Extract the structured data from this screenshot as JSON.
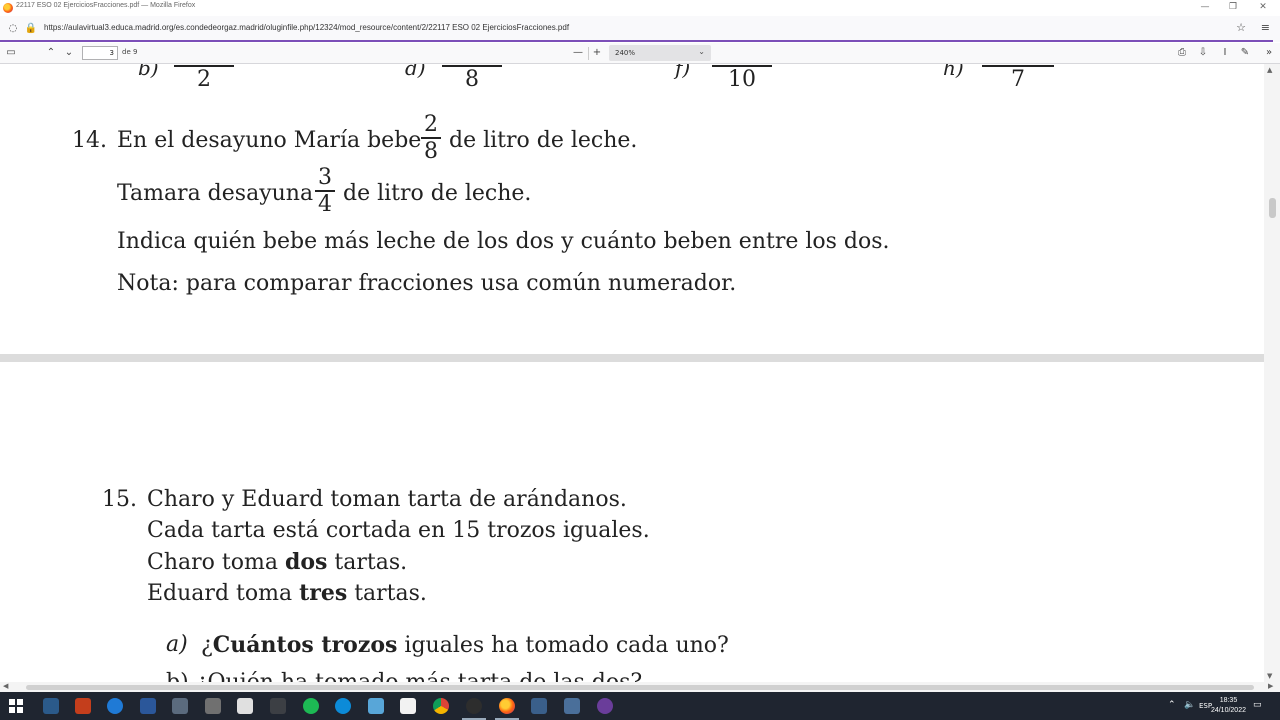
{
  "window": {
    "title": "22117 ESO 02 EjerciciosFracciones.pdf — Mozilla Firefox",
    "minimize": "—",
    "maximize": "❐",
    "close": "✕"
  },
  "urlbar": {
    "url": "https://aulavirtual3.educa.madrid.org/es.condedeorgaz.madrid/oluginfile.php/12324/mod_resource/content/2/22117 ESO 02 EjerciciosFracciones.pdf"
  },
  "pdf_toolbar": {
    "page_number": "3",
    "page_count": "de 9",
    "zoom": "240%",
    "zoom_minus": "—",
    "zoom_plus": "+"
  },
  "document": {
    "top_fragment": {
      "labels": [
        "b)",
        "d)",
        "f)",
        "h)"
      ],
      "denominators": [
        "2",
        "8",
        "10",
        "7"
      ]
    },
    "ex14": {
      "number": "14.",
      "line1_a": "En el desayuno María bebe",
      "frac1_num": "2",
      "frac1_den": "8",
      "line1_b": "de litro de leche.",
      "line2_a": "Tamara desayuna",
      "frac2_num": "3",
      "frac2_den": "4",
      "line2_b": "de litro de leche.",
      "line3": "Indica quién bebe más leche de los dos y cuánto beben entre los dos.",
      "line4": "Nota: para comparar fracciones usa común numerador."
    },
    "ex15": {
      "number": "15.",
      "line1": "Charo y Eduard toman tarta de arándanos.",
      "line2": "Cada tarta está cortada en 15 trozos iguales.",
      "line3_a": "Charo toma ",
      "line3_bold": "dos",
      "line3_b": " tartas.",
      "line4_a": "Eduard toma ",
      "line4_bold": "tres",
      "line4_b": " tartas.",
      "item_a_label": "a)",
      "item_a_pre": "¿",
      "item_a_bold": "Cuántos trozos",
      "item_a_post": " iguales ha tomado cada uno?",
      "item_b_fragment": "b)  ¿Quién ha tomado más tarta de las dos?"
    }
  },
  "taskbar": {
    "time": "18:35",
    "date": "24/10/2022"
  }
}
